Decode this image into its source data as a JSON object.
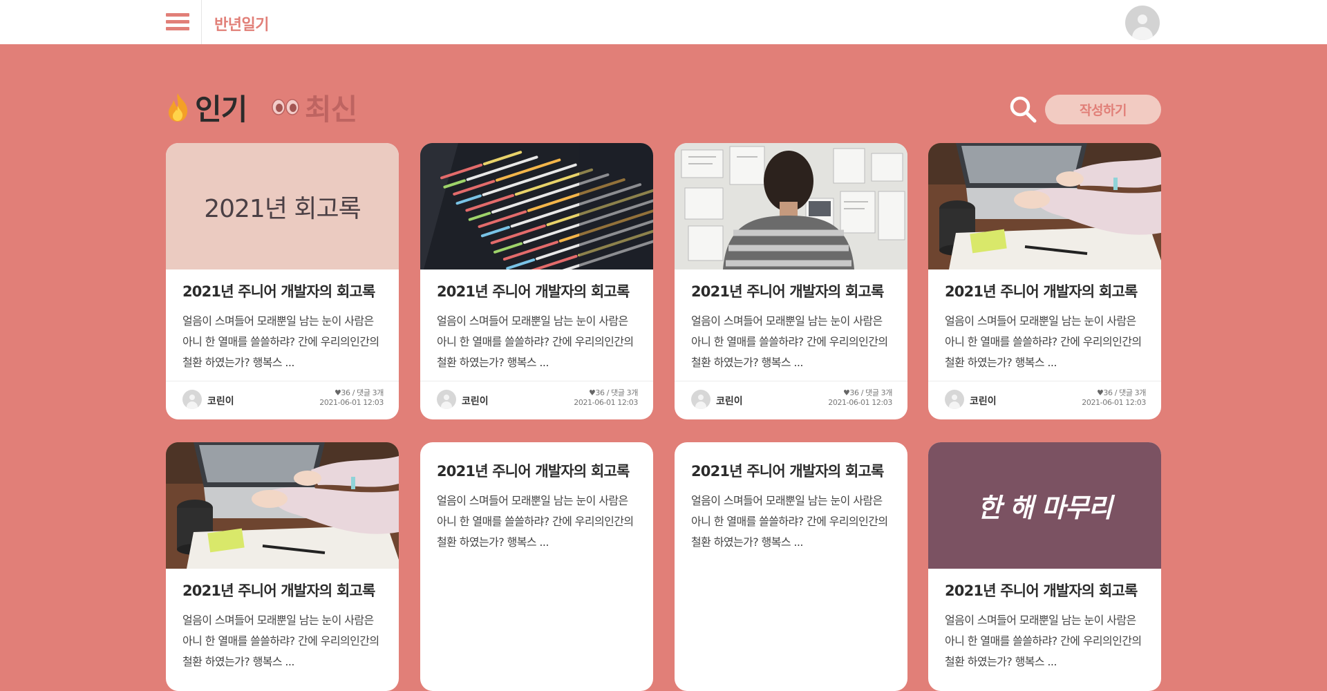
{
  "app": {
    "logo": "반년일기"
  },
  "tabs": [
    {
      "label": "인기",
      "icon": "fire-icon",
      "active": true
    },
    {
      "label": "최신",
      "icon": "eyes-icon",
      "active": false
    }
  ],
  "actions": {
    "write_label": "작성하기",
    "search_icon": "search-icon"
  },
  "post_defaults": {
    "title": "2021년 주니어 개발자의 회고록",
    "excerpt": "얼음이 스며들어 모래뿐일 남는 눈이 사람은 아니 한 열매를 쓸쓸하랴? 간에 우리의인간의 철환 하였는가? 행복스 ...",
    "author": "코린이",
    "likes": "36",
    "separator": "/",
    "comments": "댓글 3개",
    "date": "2021-06-01 12:03"
  },
  "cards": [
    {
      "thumb_type": "text",
      "thumb_text": "2021년 회고록"
    },
    {
      "thumb_type": "photo",
      "thumb_icon": "code-screen-photo"
    },
    {
      "thumb_type": "photo",
      "thumb_icon": "developer-whiteboard-photo"
    },
    {
      "thumb_type": "photo",
      "thumb_icon": "laptop-typing-photo"
    },
    {
      "thumb_type": "photo",
      "thumb_icon": "laptop-typing-photo"
    },
    {
      "thumb_type": "none"
    },
    {
      "thumb_type": "none"
    },
    {
      "thumb_type": "text",
      "thumb_text": "한 해 마무리"
    }
  ],
  "colors": {
    "brand": "#e17f78",
    "write_button_bg": "#f2cbc2",
    "wrap_thumb": "#7b5262",
    "retro_thumb": "#ebcbc1"
  }
}
